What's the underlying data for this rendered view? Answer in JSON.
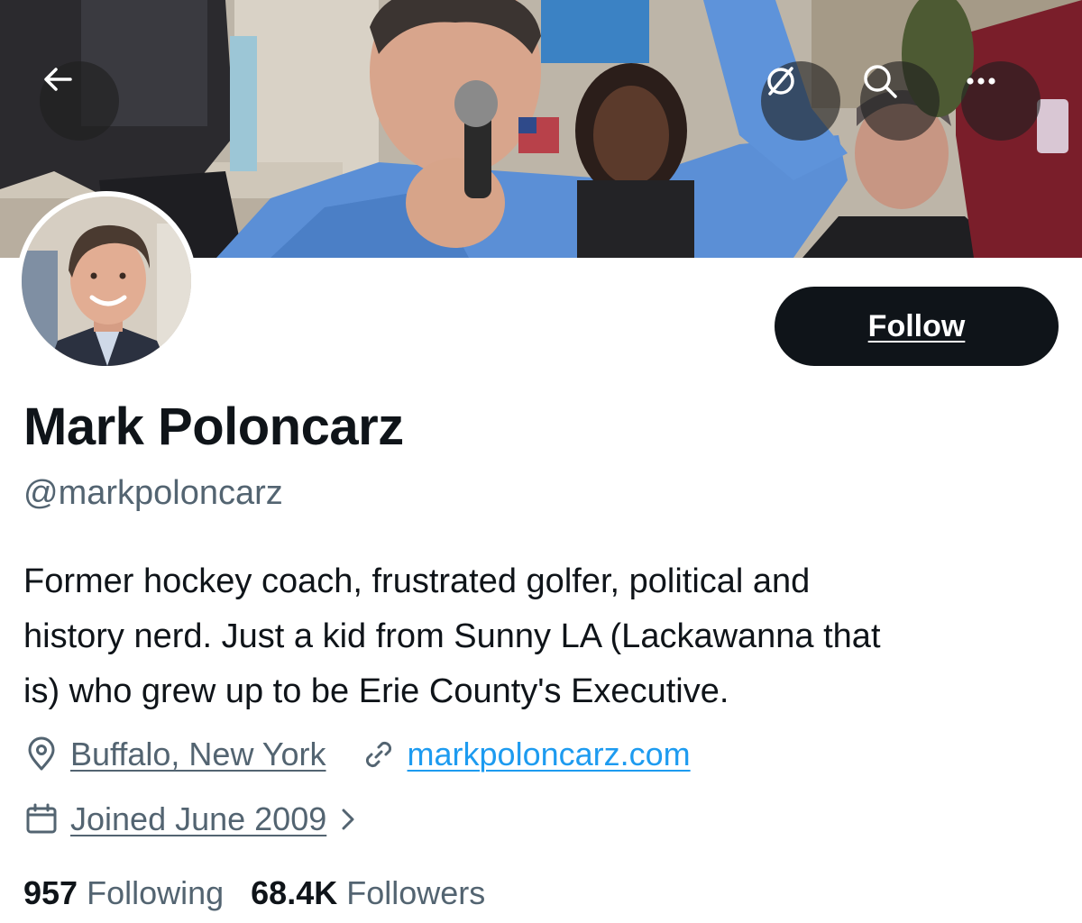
{
  "header": {
    "back_icon": "arrow-left-icon",
    "hide_icon": "eye-slash-circle-icon",
    "search_icon": "search-icon",
    "more_icon": "more-dots-icon"
  },
  "profile": {
    "name": "Mark Poloncarz",
    "handle": "@markpoloncarz",
    "follow_label": "Follow",
    "bio_lines": [
      "Former hockey coach, frustrated golfer, political and",
      "history nerd. Just a kid from Sunny LA (Lackawanna that",
      "is) who grew up to be Erie County's Executive."
    ],
    "location": "Buffalo, New York",
    "website": "markpoloncarz.com",
    "joined": "Joined June 2009",
    "following_count": "957",
    "following_label": "Following",
    "followers_count": "68.4K",
    "followers_label": "Followers"
  },
  "colors": {
    "text_primary": "#0f1419",
    "text_secondary": "#536471",
    "link_blue": "#1d9bf0",
    "follow_button_bg": "#0f1419"
  }
}
